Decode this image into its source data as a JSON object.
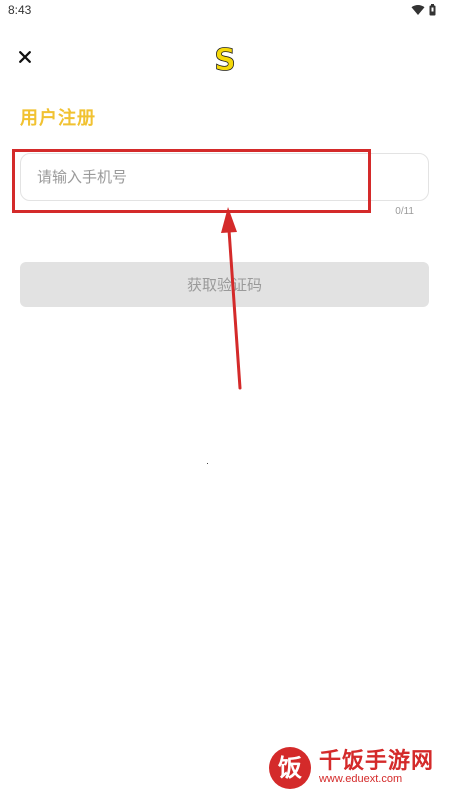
{
  "status_bar": {
    "time": "8:43",
    "icons": [
      "wifi-icon",
      "battery-icon"
    ]
  },
  "header": {
    "close_icon": "close-icon",
    "logo_letter": "S"
  },
  "title": "用户注册",
  "phone_input": {
    "placeholder": "请输入手机号",
    "value": "",
    "counter": "0/11"
  },
  "code_button": {
    "label": "获取验证码"
  },
  "watermark": {
    "logo_glyph": "饭",
    "title": "千饭手游网",
    "url": "www.eduext.com"
  },
  "colors": {
    "accent": "#f1c232",
    "annotation": "#d42a2a",
    "button_bg": "#e2e2e2",
    "muted_text": "#9a9a9a"
  }
}
